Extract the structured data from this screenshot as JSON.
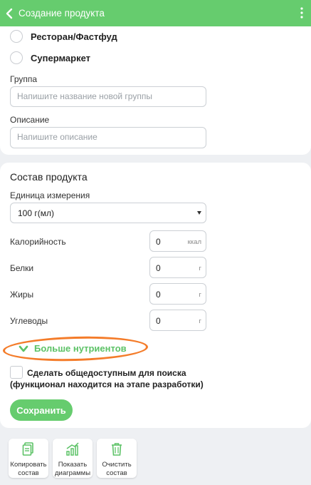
{
  "header": {
    "title": "Создание продукта",
    "back_icon": "chevron-left-icon",
    "menu_icon": "more-vert-icon"
  },
  "type_options": [
    {
      "label": "Ресторан/Фастфуд",
      "selected": false
    },
    {
      "label": "Супермаркет",
      "selected": false
    }
  ],
  "group": {
    "label": "Группа",
    "placeholder": "Напишите название новой группы"
  },
  "description": {
    "label": "Описание",
    "placeholder": "Напишите описание"
  },
  "composition": {
    "title": "Состав продукта",
    "unit_label": "Единица измерения",
    "unit_value": "100 г(мл)",
    "nutrients": [
      {
        "label": "Калорийность",
        "value": "0",
        "unit": "ккал"
      },
      {
        "label": "Белки",
        "value": "0",
        "unit": "г"
      },
      {
        "label": "Жиры",
        "value": "0",
        "unit": "г"
      },
      {
        "label": "Углеводы",
        "value": "0",
        "unit": "г"
      }
    ],
    "more_nutrients": "Больше нутриентов",
    "public_line1": "Сделать общедоступным для поиска",
    "public_line2": "(функционал находится на этапе разработки)",
    "save_label": "Сохранить"
  },
  "tools": [
    {
      "line1": "Копировать",
      "line2": "состав",
      "icon": "copy-icon"
    },
    {
      "line1": "Показать",
      "line2": "диаграммы",
      "icon": "chart-icon"
    },
    {
      "line1": "Очистить",
      "line2": "состав",
      "icon": "trash-icon"
    }
  ],
  "colors": {
    "accent": "#66cc6e",
    "annotation": "#f47c2a"
  }
}
